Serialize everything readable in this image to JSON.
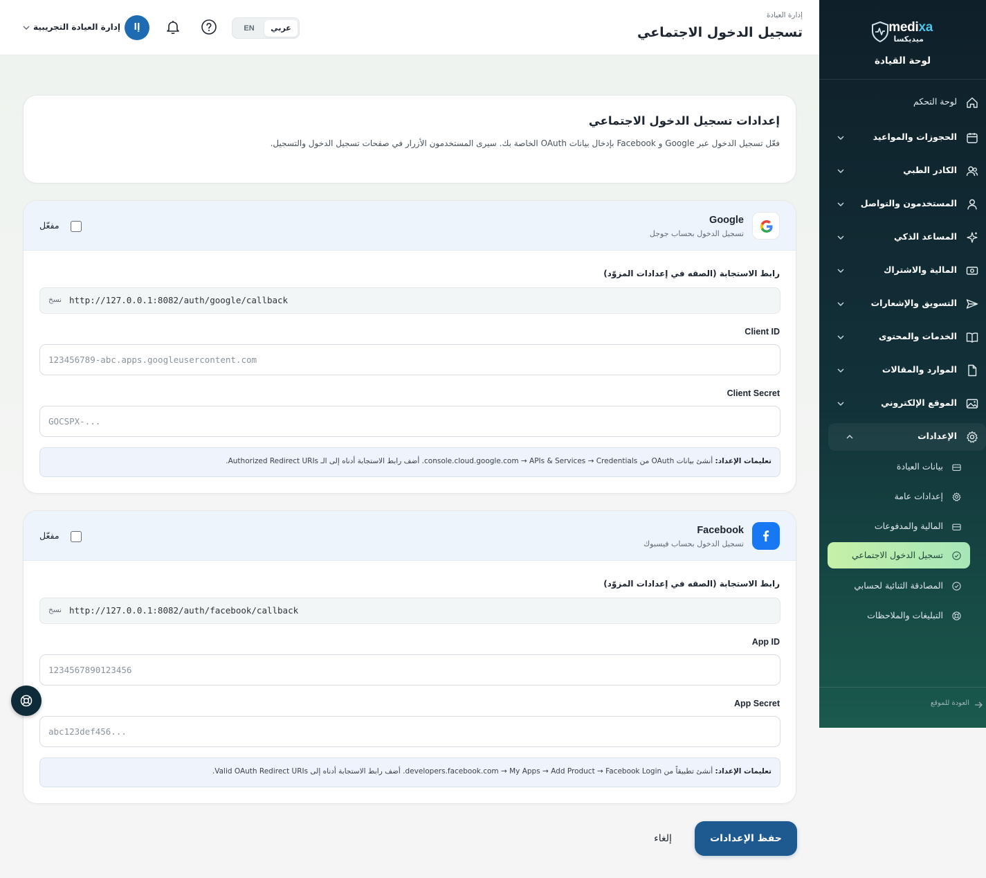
{
  "brand": {
    "name_a": "medi",
    "name_b": "xa",
    "name_ar": "ميديكسا",
    "accent": "#4fc3e6"
  },
  "sidebar": {
    "title": "لوحة القيادة",
    "items": [
      {
        "label": "لوحة التحكم",
        "icon": "home-icon",
        "chevron": false
      },
      {
        "label": "الحجوزات والمواعيد",
        "icon": "calendar-icon",
        "chevron": true
      },
      {
        "label": "الكادر الطبي",
        "icon": "users-icon",
        "chevron": true
      },
      {
        "label": "المستخدمون والتواصل",
        "icon": "user-icon",
        "chevron": true
      },
      {
        "label": "المساعد الذكي",
        "icon": "sparkles-icon",
        "chevron": true
      },
      {
        "label": "المالية والاشتراك",
        "icon": "money-icon",
        "chevron": true
      },
      {
        "label": "التسويق والإشعارات",
        "icon": "send-icon",
        "chevron": true
      },
      {
        "label": "الخدمات والمحتوى",
        "icon": "book-icon",
        "chevron": true
      },
      {
        "label": "الموارد والمقالات",
        "icon": "file-icon",
        "chevron": true
      },
      {
        "label": "الموقع الإلكتروني",
        "icon": "image-icon",
        "chevron": true
      },
      {
        "label": "الإعدادات",
        "icon": "gear-icon",
        "chevron": true,
        "expanded": true
      }
    ],
    "sub_items": [
      {
        "label": "بيانات العيادة",
        "icon": "briefcase-icon"
      },
      {
        "label": "إعدادات عامة",
        "icon": "gear-icon"
      },
      {
        "label": "المالية والمدفوعات",
        "icon": "briefcase-icon"
      },
      {
        "label": "تسجيل الدخول الاجتماعي",
        "icon": "check-circle-icon",
        "active": true
      },
      {
        "label": "المصادقة الثنائية لحسابي",
        "icon": "check-circle-icon"
      },
      {
        "label": "التبليغات والملاحظات",
        "icon": "lifebuoy-icon"
      }
    ],
    "back_link": "العودة للموقع"
  },
  "header": {
    "breadcrumb": "إدارة العيادة",
    "title": "تسجيل الدخول الاجتماعي",
    "lang_ar": "عربي",
    "lang_en": "EN",
    "user_name": "إدارة العيادة التجريبية",
    "avatar_initials": "إا"
  },
  "intro": {
    "title": "إعدادات تسجيل الدخول الاجتماعي",
    "description": "فعّل تسجيل الدخول عبر Google و Facebook بإدخال بيانات OAuth الخاصة بك. سيرى المستخدمون الأزرار في صفحات تسجيل الدخول والتسجيل."
  },
  "providers": {
    "google": {
      "name": "Google",
      "subtitle": "تسجيل الدخول بحساب جوجل",
      "enable_label": "مفعّل",
      "enabled": false,
      "callback_label": "رابط الاستجابة (الصقه في إعدادات المزوّد)",
      "callback_url": "http://127.0.0.1:8082/auth/google/callback",
      "copy_label": "نسخ",
      "id_label": "Client ID",
      "id_placeholder": "123456789-abc.apps.googleusercontent.com",
      "secret_label": "Client Secret",
      "secret_placeholder": "GOCSPX-...",
      "hint_bold": "تعليمات الإعداد:",
      "hint_text": "أنشئ بيانات OAuth من console.cloud.google.com → APIs & Services → Credentials. أضف رابط الاستجابة أدناه إلى الـ Authorized Redirect URIs."
    },
    "facebook": {
      "name": "Facebook",
      "subtitle": "تسجيل الدخول بحساب فيسبوك",
      "enable_label": "مفعّل",
      "enabled": false,
      "callback_label": "رابط الاستجابة (الصقه في إعدادات المزوّد)",
      "callback_url": "http://127.0.0.1:8082/auth/facebook/callback",
      "copy_label": "نسخ",
      "id_label": "App ID",
      "id_placeholder": "1234567890123456",
      "secret_label": "App Secret",
      "secret_placeholder": "abc123def456...",
      "hint_bold": "تعليمات الإعداد:",
      "hint_text": "أنشئ تطبيقاً من developers.facebook.com → My Apps → Add Product → Facebook Login. أضف رابط الاستجابة أدناه إلى Valid OAuth Redirect URIs."
    }
  },
  "actions": {
    "save": "حفظ الإعدادات",
    "cancel": "إلغاء"
  },
  "colors": {
    "primary": "#1e5a8f",
    "sidebar_dark": "#0f1f29",
    "active_green": "#c6f0a8"
  }
}
